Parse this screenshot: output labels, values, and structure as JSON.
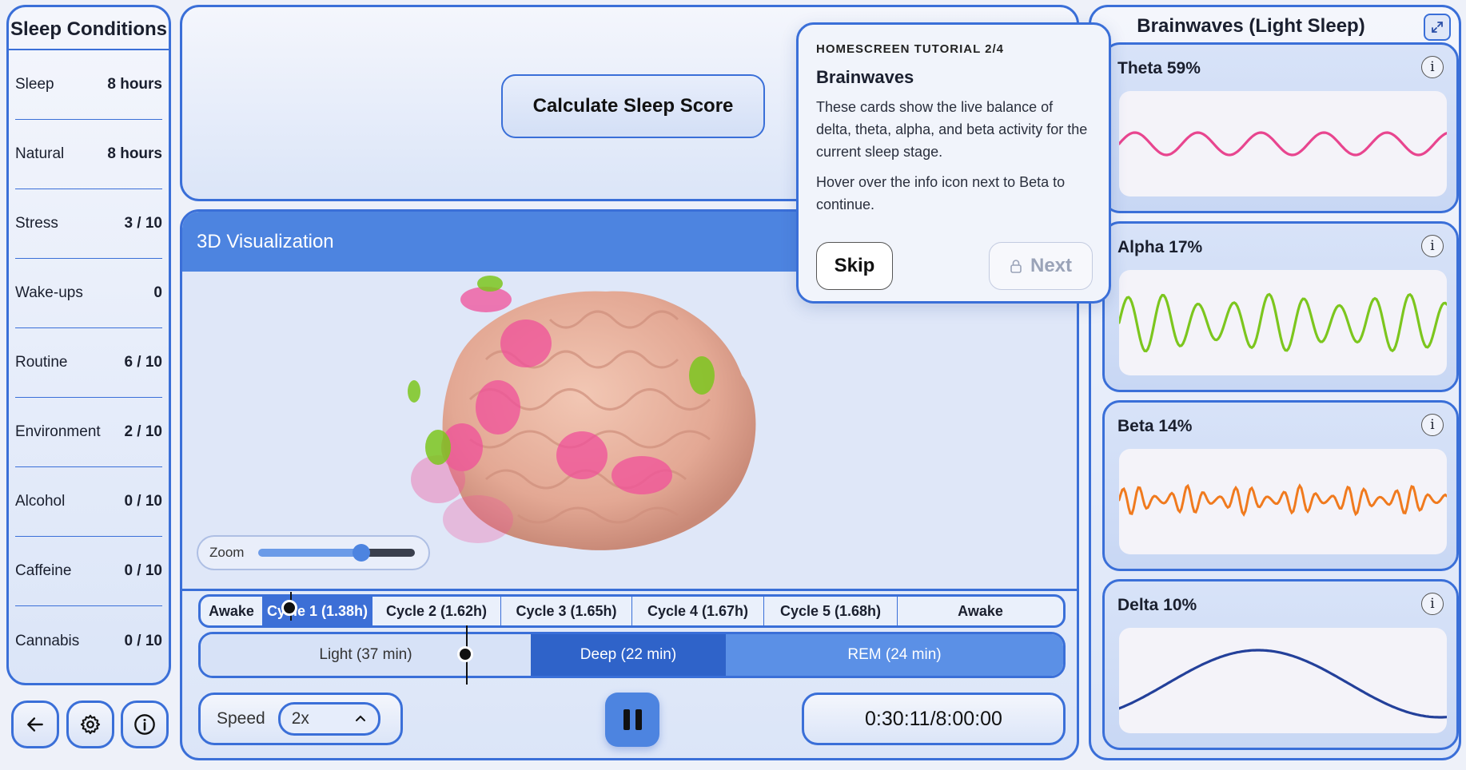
{
  "left": {
    "title": "Sleep Conditions",
    "conditions": [
      {
        "label": "Sleep",
        "value": "8 hours"
      },
      {
        "label": "Natural",
        "value": "8 hours"
      },
      {
        "label": "Stress",
        "value": "3 / 10"
      },
      {
        "label": "Wake-ups",
        "value": "0"
      },
      {
        "label": "Routine",
        "value": "6 / 10"
      },
      {
        "label": "Environment",
        "value": "2 / 10"
      },
      {
        "label": "Alcohol",
        "value": "0 / 10"
      },
      {
        "label": "Caffeine",
        "value": "0 / 10"
      },
      {
        "label": "Cannabis",
        "value": "0 / 10"
      }
    ]
  },
  "top": {
    "calc_label": "Calculate Sleep Score"
  },
  "viz": {
    "title": "3D Visualization",
    "zoom_label": "Zoom",
    "zoom_level": 0.65,
    "cycles": [
      "Awake",
      "Cycle 1 (1.38h)",
      "Cycle 2 (1.62h)",
      "Cycle 3 (1.65h)",
      "Cycle 4 (1.67h)",
      "Cycle 5 (1.68h)",
      "Awake"
    ],
    "stages": [
      "Light (37 min)",
      "Deep (22 min)",
      "REM (24 min)"
    ],
    "speed_label": "Speed",
    "speed_value": "2x",
    "time": "0:30:11/8:00:00"
  },
  "right": {
    "title": "Brainwaves (Light Sleep)",
    "waves": [
      {
        "label": "Theta 59%",
        "color": "#e8458f"
      },
      {
        "label": "Alpha 17%",
        "color": "#7cc61e"
      },
      {
        "label": "Beta 14%",
        "color": "#f07a1e"
      },
      {
        "label": "Delta 10%",
        "color": "#23409a"
      }
    ],
    "info_glyph": "i"
  },
  "tutorial": {
    "step": "HOMESCREEN TUTORIAL 2/4",
    "title": "Brainwaves",
    "body1": "These cards show the live balance of delta, theta, alpha, and beta activity for the current sleep stage.",
    "body2": "Hover over the info icon next to Beta to continue.",
    "skip": "Skip",
    "next": "Next"
  }
}
